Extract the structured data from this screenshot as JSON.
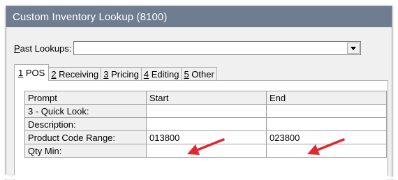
{
  "window": {
    "title": "Custom Inventory Lookup (8100)"
  },
  "past_lookups": {
    "label_u": "P",
    "label_rest": "ast Lookups:",
    "value": ""
  },
  "tabs": [
    {
      "num": "1",
      "label": " POS"
    },
    {
      "num": "2",
      "label": " Receiving"
    },
    {
      "num": "3",
      "label": " Pricing"
    },
    {
      "num": "4",
      "label": " Editing"
    },
    {
      "num": "5",
      "label": " Other"
    }
  ],
  "grid": {
    "headers": [
      "Prompt",
      "Start",
      "End"
    ],
    "rows": [
      {
        "prompt": "3 - Quick Look:",
        "start": "",
        "end": ""
      },
      {
        "prompt": "Description:",
        "start": "",
        "end": ""
      },
      {
        "prompt": "Product Code Range:",
        "start": "013800",
        "end": "023800"
      },
      {
        "prompt": "Qty Min:",
        "start": "",
        "end": ""
      }
    ]
  },
  "colors": {
    "titlebar": "#6f7d91",
    "arrow": "#e0282e"
  }
}
